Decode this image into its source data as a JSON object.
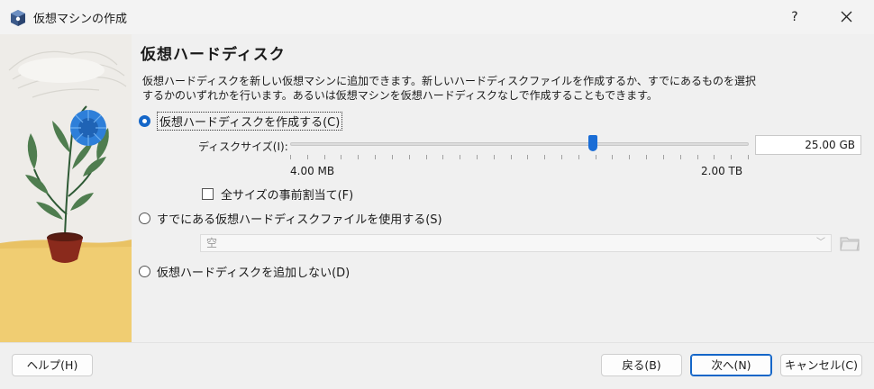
{
  "window": {
    "title": "仮想マシンの作成",
    "help_glyph": "?",
    "close_glyph": "✕"
  },
  "page": {
    "heading": "仮想ハードディスク",
    "description": "仮想ハードディスクを新しい仮想マシンに追加できます。新しいハードディスクファイルを作成するか、すでにあるものを選択\nするかのいずれかを行います。あるいは仮想マシンを仮想ハードディスクなしで作成することもできます。"
  },
  "options": {
    "create_label": "仮想ハードディスクを作成する(C)",
    "existing_label": "すでにある仮想ハードディスクファイルを使用する(S)",
    "none_label": "仮想ハードディスクを追加しない(D)"
  },
  "disk": {
    "size_label": "ディスクサイズ(I):",
    "size_value": "25.00 GB",
    "min_label": "4.00 MB",
    "max_label": "2.00 TB",
    "slider_fraction": 0.66,
    "preallocate_label": "全サイズの事前割当て(F)"
  },
  "existing_file": {
    "value": "空"
  },
  "buttons": {
    "help": "ヘルプ(H)",
    "back": "戻る(B)",
    "next": "次へ(N)",
    "cancel": "キャンセル(C)"
  },
  "colors": {
    "accent": "#1466c8",
    "flower": "#2e7fd9",
    "pot": "#8a2a1c",
    "floor": "#f0cd72"
  }
}
